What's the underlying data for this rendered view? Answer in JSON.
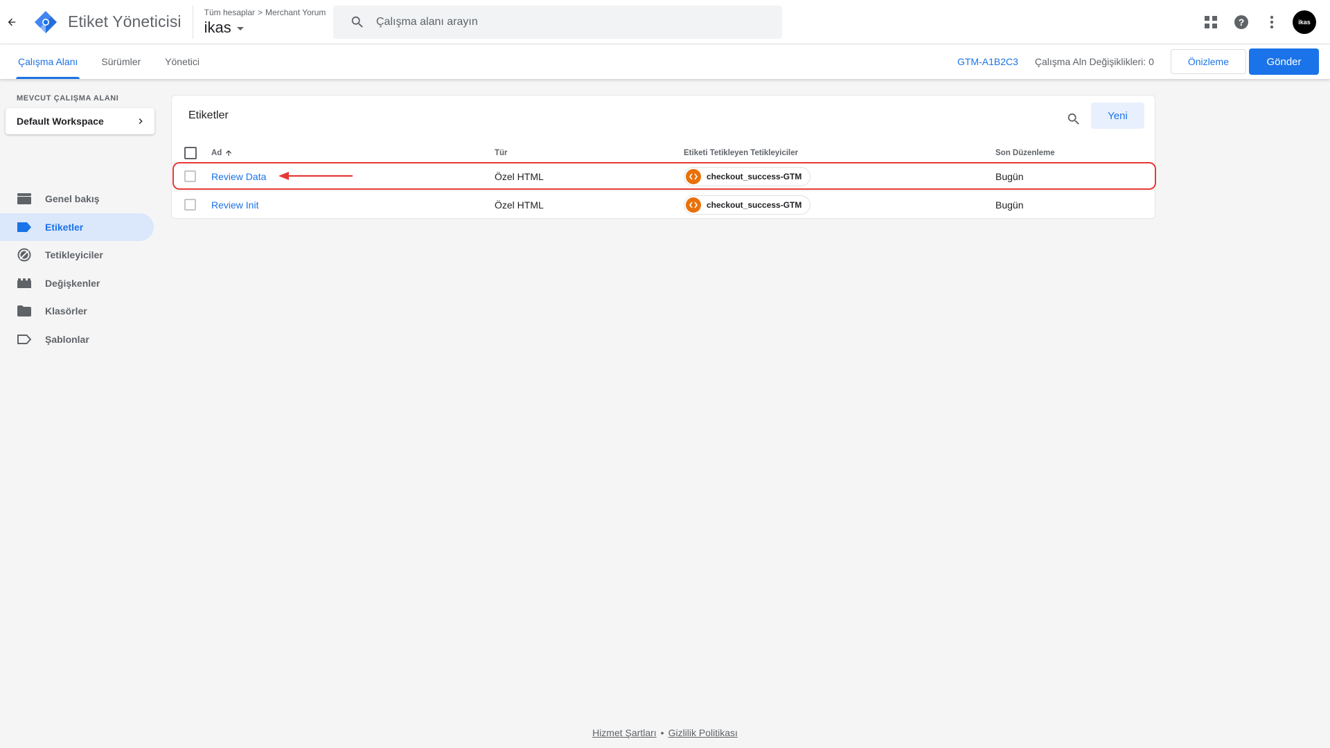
{
  "header": {
    "app_title": "Etiket Yöneticisi",
    "breadcrumb_account": "Tüm hesaplar",
    "breadcrumb_separator": ">",
    "breadcrumb_container": "Merchant Yorum",
    "container_name": "ikas",
    "search_placeholder": "Çalışma alanı arayın",
    "avatar_text": "ikas"
  },
  "subnav": {
    "tabs": [
      {
        "label": "Çalışma Alanı",
        "active": true
      },
      {
        "label": "Sürümler",
        "active": false
      },
      {
        "label": "Yönetici",
        "active": false
      }
    ],
    "container_id": "GTM-A1B2C3",
    "workspace_changes": "Çalışma Aln Değişiklikleri: 0",
    "preview_label": "Önizleme",
    "submit_label": "Gönder"
  },
  "sidebar": {
    "workspace_label": "MEVCUT ÇALIŞMA ALANI",
    "workspace_name": "Default Workspace",
    "items": [
      {
        "label": "Genel bakış",
        "icon": "overview-icon",
        "active": false
      },
      {
        "label": "Etiketler",
        "icon": "tag-icon",
        "active": true
      },
      {
        "label": "Tetikleyiciler",
        "icon": "trigger-icon",
        "active": false
      },
      {
        "label": "Değişkenler",
        "icon": "variables-icon",
        "active": false
      },
      {
        "label": "Klasörler",
        "icon": "folder-icon",
        "active": false
      },
      {
        "label": "Şablonlar",
        "icon": "template-icon",
        "active": false
      }
    ]
  },
  "tags_card": {
    "title": "Etiketler",
    "new_button": "Yeni",
    "columns": [
      "Ad",
      "Tür",
      "Etiketi Tetikleyen Tetikleyiciler",
      "Son Düzenleme"
    ],
    "rows": [
      {
        "name": "Review Data",
        "type": "Özel HTML",
        "trigger": "checkout_success-GTM",
        "modified": "Bugün",
        "highlighted": true
      },
      {
        "name": "Review Init",
        "type": "Özel HTML",
        "trigger": "checkout_success-GTM",
        "modified": "Bugün",
        "highlighted": false
      }
    ]
  },
  "footer": {
    "terms": "Hizmet Şartları",
    "separator": "•",
    "privacy": "Gizlilik Politikası"
  },
  "colors": {
    "accent": "#1a73e8",
    "trigger_orange": "#e8710a",
    "highlight_red": "#e53935",
    "active_nav_bg": "#dbe7fb"
  }
}
